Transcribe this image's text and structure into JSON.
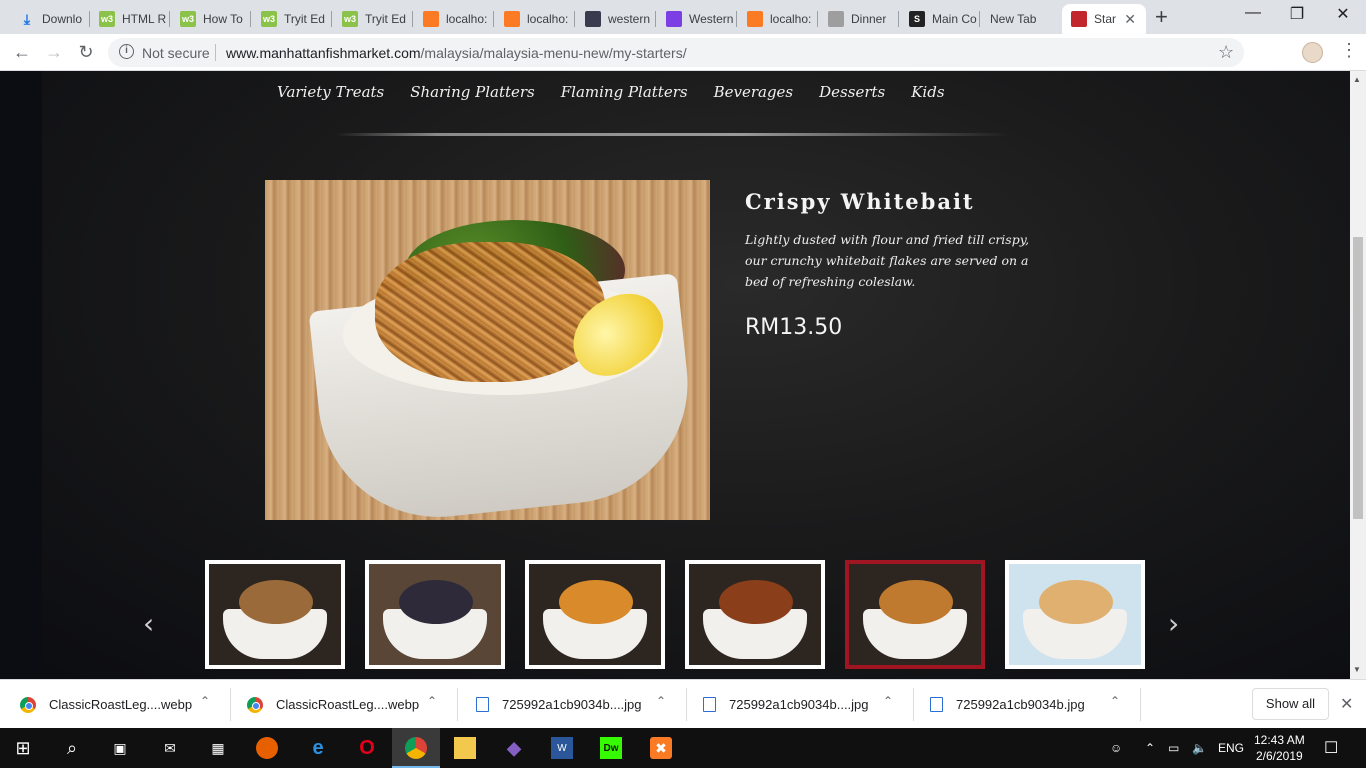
{
  "browser": {
    "tabs": [
      {
        "title": "Downlo",
        "icon": "download-icon",
        "color": "#1a73e8"
      },
      {
        "title": "HTML R",
        "icon": "w3schools-icon",
        "color": "#8bc34a"
      },
      {
        "title": "How To",
        "icon": "w3schools-icon",
        "color": "#8bc34a"
      },
      {
        "title": "Tryit Ed",
        "icon": "w3schools-icon",
        "color": "#8bc34a"
      },
      {
        "title": "Tryit Ed",
        "icon": "w3schools-icon",
        "color": "#8bc34a"
      },
      {
        "title": "localho:",
        "icon": "xampp-icon",
        "color": "#fb7a24"
      },
      {
        "title": "localho:",
        "icon": "xampp-icon",
        "color": "#fb7a24"
      },
      {
        "title": "western",
        "icon": "site-icon",
        "color": "#3b3b4f"
      },
      {
        "title": "Western",
        "icon": "play-icon",
        "color": "#7b3fe4"
      },
      {
        "title": "localho:",
        "icon": "xampp-icon",
        "color": "#fb7a24"
      },
      {
        "title": "Dinner",
        "icon": "page-icon",
        "color": "#9e9e9e"
      },
      {
        "title": "Main Co",
        "icon": "s-icon",
        "color": "#222222"
      },
      {
        "title": "New Tab",
        "icon": "",
        "color": ""
      },
      {
        "title": "Star",
        "icon": "manhattan-logo-icon",
        "color": "#c1272d",
        "active": true
      }
    ],
    "url_host": "www.manhattanfishmarket.com",
    "url_path": "/malaysia/malaysia-menu-new/my-starters/",
    "security_label": "Not secure"
  },
  "site": {
    "categories": [
      "Variety Treats",
      "Sharing Platters",
      "Flaming Platters",
      "Beverages",
      "Desserts",
      "Kids"
    ],
    "dish": {
      "title": "Crispy Whitebait",
      "description": "Lightly dusted with flour and fried till crispy, our crunchy whitebait flakes are served on a bed of refreshing coleslaw.",
      "price": "RM13.50"
    },
    "thumbnails": [
      {
        "name": "calamari-dip",
        "food_color": "#9a6a3a"
      },
      {
        "name": "mussels-platter",
        "food_color": "#2e2a3a"
      },
      {
        "name": "fish-and-chips",
        "food_color": "#d98a2a"
      },
      {
        "name": "fried-chicken",
        "food_color": "#8a3e1a"
      },
      {
        "name": "crispy-whitebait",
        "food_color": "#c07a30",
        "active": true
      },
      {
        "name": "prawn-cups",
        "food_color": "#e0b070"
      }
    ],
    "accent_color": "#a01522"
  },
  "downloads": [
    {
      "name": "ClassicRoastLeg....webp",
      "type": "chrome"
    },
    {
      "name": "ClassicRoastLeg....webp",
      "type": "chrome"
    },
    {
      "name": "725992a1cb9034b....jpg",
      "type": "img"
    },
    {
      "name": "725992a1cb9034b....jpg",
      "type": "img"
    },
    {
      "name": "725992a1cb9034b.jpg",
      "type": "img"
    }
  ],
  "downloads_show_all": "Show all",
  "taskbar": {
    "language": "ENG",
    "time": "12:43 AM",
    "date": "2/6/2019"
  }
}
